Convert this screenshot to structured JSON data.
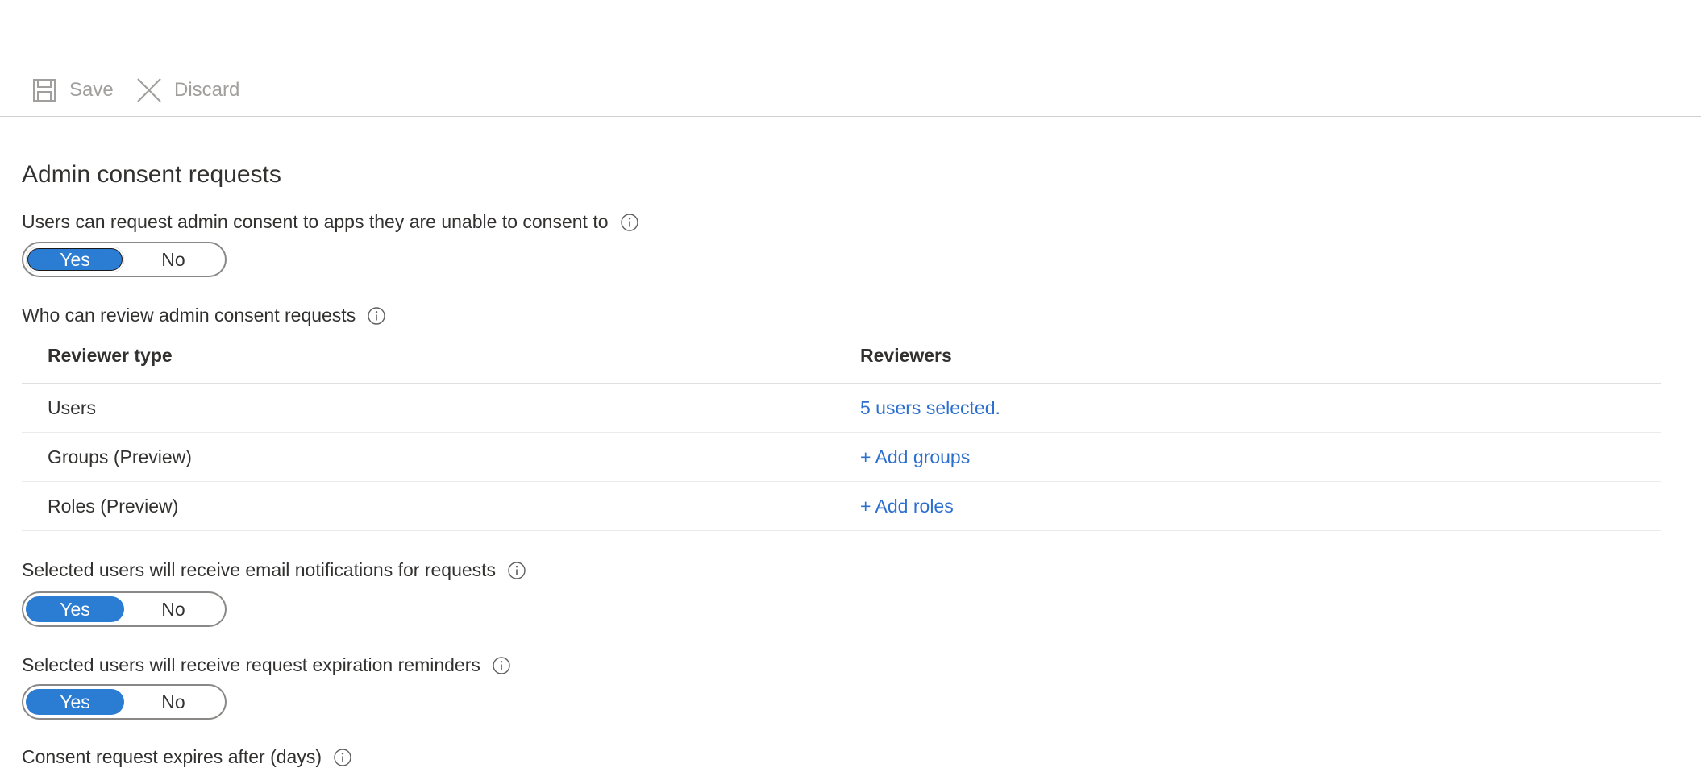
{
  "toolbar": {
    "save_label": "Save",
    "discard_label": "Discard"
  },
  "section_title": "Admin consent requests",
  "request_consent": {
    "label": "Users can request admin consent to apps they are unable to consent to",
    "yes": "Yes",
    "no": "No",
    "selected": "Yes"
  },
  "reviewers": {
    "label": "Who can review admin consent requests",
    "headers": {
      "type": "Reviewer type",
      "reviewers": "Reviewers"
    },
    "rows": [
      {
        "type": "Users",
        "value": "5 users selected."
      },
      {
        "type": "Groups (Preview)",
        "value": "+ Add groups"
      },
      {
        "type": "Roles (Preview)",
        "value": "+ Add roles"
      }
    ]
  },
  "email_notifications": {
    "label": "Selected users will receive email notifications for requests",
    "yes": "Yes",
    "no": "No",
    "selected": "Yes"
  },
  "expiration_reminders": {
    "label": "Selected users will receive request expiration reminders",
    "yes": "Yes",
    "no": "No",
    "selected": "Yes"
  },
  "expires_after": {
    "label": "Consent request expires after (days)"
  },
  "icons": {
    "save": "save-icon",
    "discard": "close-icon",
    "info": "info-icon"
  },
  "colors": {
    "accent": "#2b7cd3",
    "link": "#2b6fcf",
    "disabled_text": "#a19f9d"
  }
}
